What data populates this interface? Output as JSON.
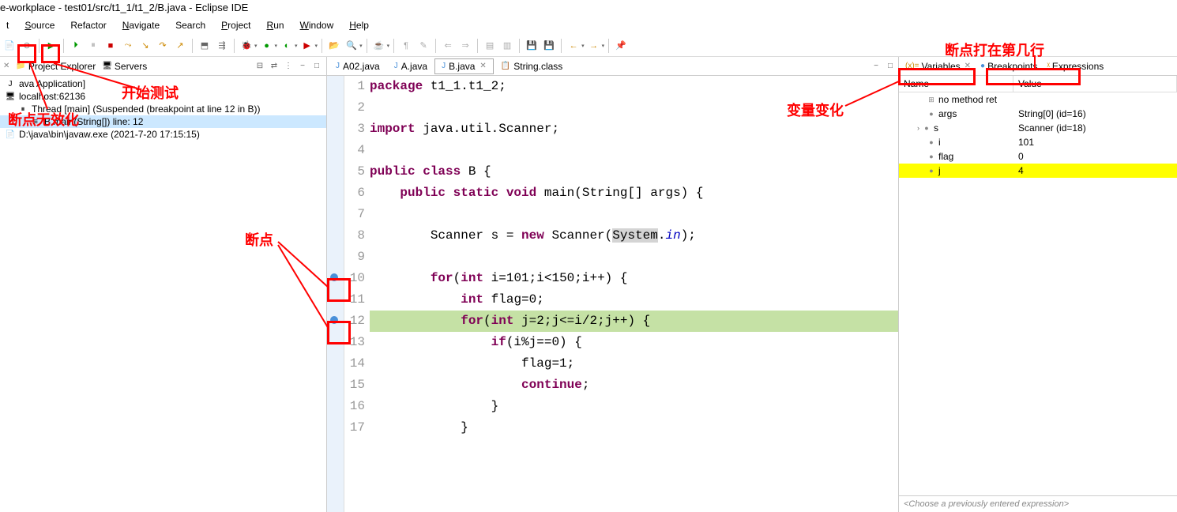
{
  "title": "e-workplace - test01/src/t1_1/t1_2/B.java - Eclipse IDE",
  "menu": [
    "Source",
    "Refactor",
    "Navigate",
    "Search",
    "Project",
    "Run",
    "Window",
    "Help"
  ],
  "menu_underline": [
    "S",
    "",
    "N",
    "",
    "P",
    "R",
    "W",
    "H"
  ],
  "sidebar": {
    "tabs": [
      "Project Explorer",
      "Servers"
    ],
    "debug_rows": [
      {
        "indent": 0,
        "icon": "J",
        "text": "ava Application]"
      },
      {
        "indent": 0,
        "icon": "🖥",
        "text": "localhost:62136"
      },
      {
        "indent": 1,
        "icon": "⏸",
        "text": "Thread [main] (Suspended (breakpoint at line 12 in B))"
      },
      {
        "indent": 2,
        "icon": "≡",
        "text": "B.main(String[]) line: 12",
        "selected": true
      },
      {
        "indent": 0,
        "icon": "📄",
        "text": "D:\\java\\bin\\javaw.exe (2021-7-20 17:15:15)"
      }
    ]
  },
  "editor_tabs": [
    {
      "icon": "J",
      "label": "A02.java"
    },
    {
      "icon": "J",
      "label": "A.java"
    },
    {
      "icon": "J",
      "label": "B.java",
      "active": true,
      "close": true
    },
    {
      "icon": "📋",
      "label": "String.class"
    }
  ],
  "code": [
    {
      "n": 1,
      "tokens": [
        {
          "t": "package",
          "c": "kw"
        },
        {
          "t": " t1_1.t1_2;"
        }
      ]
    },
    {
      "n": 2,
      "tokens": []
    },
    {
      "n": 3,
      "tokens": [
        {
          "t": "import",
          "c": "kw"
        },
        {
          "t": " java.util.Scanner;"
        }
      ]
    },
    {
      "n": 4,
      "tokens": []
    },
    {
      "n": 5,
      "tokens": [
        {
          "t": "public class",
          "c": "kw"
        },
        {
          "t": " B {"
        }
      ]
    },
    {
      "n": 6,
      "tokens": [
        {
          "t": "    "
        },
        {
          "t": "public static void",
          "c": "kw"
        },
        {
          "t": " main(String[] args) {"
        }
      ]
    },
    {
      "n": 7,
      "tokens": []
    },
    {
      "n": 8,
      "tokens": [
        {
          "t": "        Scanner s = "
        },
        {
          "t": "new",
          "c": "kw"
        },
        {
          "t": " Scanner("
        },
        {
          "t": "System",
          "c": "hl-sel"
        },
        {
          "t": "."
        },
        {
          "t": "in",
          "c": "fld"
        },
        {
          "t": ");"
        }
      ]
    },
    {
      "n": 9,
      "tokens": []
    },
    {
      "n": 10,
      "bp": true,
      "tokens": [
        {
          "t": "        "
        },
        {
          "t": "for",
          "c": "kw"
        },
        {
          "t": "("
        },
        {
          "t": "int",
          "c": "kw"
        },
        {
          "t": " i=101;i<150;i++) {"
        }
      ]
    },
    {
      "n": 11,
      "tokens": [
        {
          "t": "            "
        },
        {
          "t": "int",
          "c": "kw"
        },
        {
          "t": " flag=0;"
        }
      ]
    },
    {
      "n": 12,
      "bp": true,
      "hl": "current",
      "tokens": [
        {
          "t": "            "
        },
        {
          "t": "for",
          "c": "kw"
        },
        {
          "t": "("
        },
        {
          "t": "int",
          "c": "kw"
        },
        {
          "t": " j=2;j<=i/2;j++) {"
        }
      ]
    },
    {
      "n": 13,
      "tokens": [
        {
          "t": "                "
        },
        {
          "t": "if",
          "c": "kw"
        },
        {
          "t": "(i%j==0) {"
        }
      ]
    },
    {
      "n": 14,
      "tokens": [
        {
          "t": "                    flag=1;"
        }
      ]
    },
    {
      "n": 15,
      "tokens": [
        {
          "t": "                    "
        },
        {
          "t": "continue",
          "c": "kw"
        },
        {
          "t": ";"
        }
      ]
    },
    {
      "n": 16,
      "tokens": [
        {
          "t": "                }"
        }
      ]
    },
    {
      "n": 17,
      "tokens": [
        {
          "t": "            }"
        }
      ]
    }
  ],
  "vars_tabs": [
    "Variables",
    "Breakpoints",
    "Expressions"
  ],
  "vars_header": {
    "name": "Name",
    "value": "Value"
  },
  "variables": [
    {
      "icon": "⊞",
      "name": "no method ret",
      "value": ""
    },
    {
      "icon": "●",
      "name": "args",
      "value": "String[0]  (id=16)"
    },
    {
      "icon": "●",
      "name": "s",
      "value": "Scanner  (id=18)",
      "expand": true
    },
    {
      "icon": "●",
      "name": "i",
      "value": "101"
    },
    {
      "icon": "●",
      "name": "flag",
      "value": "0"
    },
    {
      "icon": "●",
      "name": "j",
      "value": "4",
      "hl": true
    }
  ],
  "expr_placeholder": "<Choose a previously entered expression>",
  "annotations": {
    "start_test": "开始测试",
    "bp_disable": "断点无效化",
    "breakpoint": "断点",
    "var_change": "变量变化",
    "bp_line": "断点打在第几行"
  }
}
